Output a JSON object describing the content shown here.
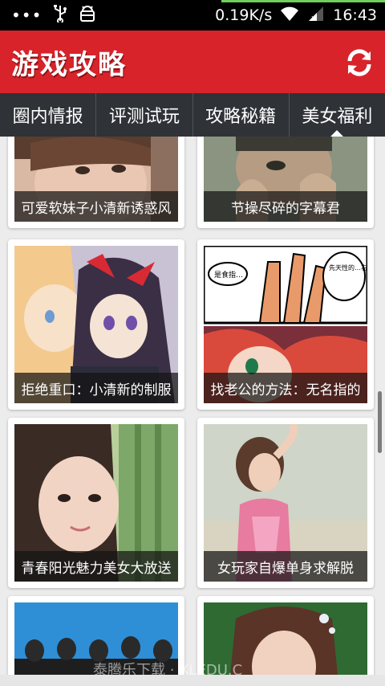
{
  "status_bar": {
    "left_icons": [
      "more-dots-icon",
      "usb-icon",
      "android-debug-icon"
    ],
    "dots": "•••",
    "speed": "0.19K/s",
    "time": "16:43"
  },
  "header": {
    "title": "游戏攻略",
    "background": "#d8232a",
    "refresh_icon": "refresh-icon"
  },
  "tabs": [
    {
      "label": "圈内情报",
      "selected": false
    },
    {
      "label": "评测试玩",
      "selected": false
    },
    {
      "label": "攻略秘籍",
      "selected": false
    },
    {
      "label": "美女福利",
      "selected": true
    }
  ],
  "cards": [
    {
      "caption": "可爱软妹子小清新诱惑风"
    },
    {
      "caption": "节操尽碎的字幕君"
    },
    {
      "caption": "拒绝重口：小清新的制服"
    },
    {
      "caption": "找老公的方法：无名指的"
    },
    {
      "caption": "青春阳光魅力美女大放送"
    },
    {
      "caption": "女玩家自爆单身求解脱"
    },
    {
      "caption": ""
    },
    {
      "caption": ""
    }
  ],
  "comic_bubbles": [
    "是食指…",
    "先天性的…右手食指比较短…"
  ],
  "watermark": "泰腾乐下载 · XLEDU.C"
}
